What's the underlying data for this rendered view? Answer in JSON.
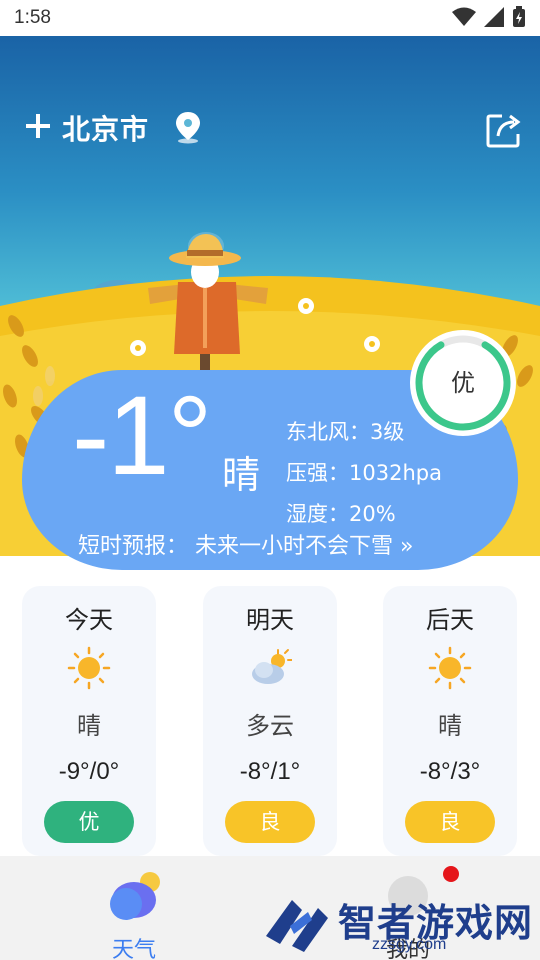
{
  "status_bar": {
    "time": "1:58"
  },
  "header": {
    "city": "北京市"
  },
  "current": {
    "temperature": "-1°",
    "condition": "晴",
    "wind": "东北风：3级",
    "pressure": "压强：1032hpa",
    "humidity": "湿度：20%",
    "short_forecast": "短时预报： 未来一小时不会下雪 »"
  },
  "aqi": {
    "label": "优",
    "color": "#3cc78b"
  },
  "forecast": [
    {
      "name": "今天",
      "icon": "sun-icon",
      "condition": "晴",
      "range": "-9°/0°",
      "aqi": "优",
      "badge_color": "#2fb27e"
    },
    {
      "name": "明天",
      "icon": "partly-cloudy-icon",
      "condition": "多云",
      "range": "-8°/1°",
      "aqi": "良",
      "badge_color": "#f8c428"
    },
    {
      "name": "后天",
      "icon": "sun-icon",
      "condition": "晴",
      "range": "-8°/3°",
      "aqi": "良",
      "badge_color": "#f8c428"
    }
  ],
  "nav": {
    "weather_label": "天气",
    "mine_label": "我的"
  },
  "watermark": {
    "title": "智者游戏网",
    "url": "zzsgy.com"
  }
}
